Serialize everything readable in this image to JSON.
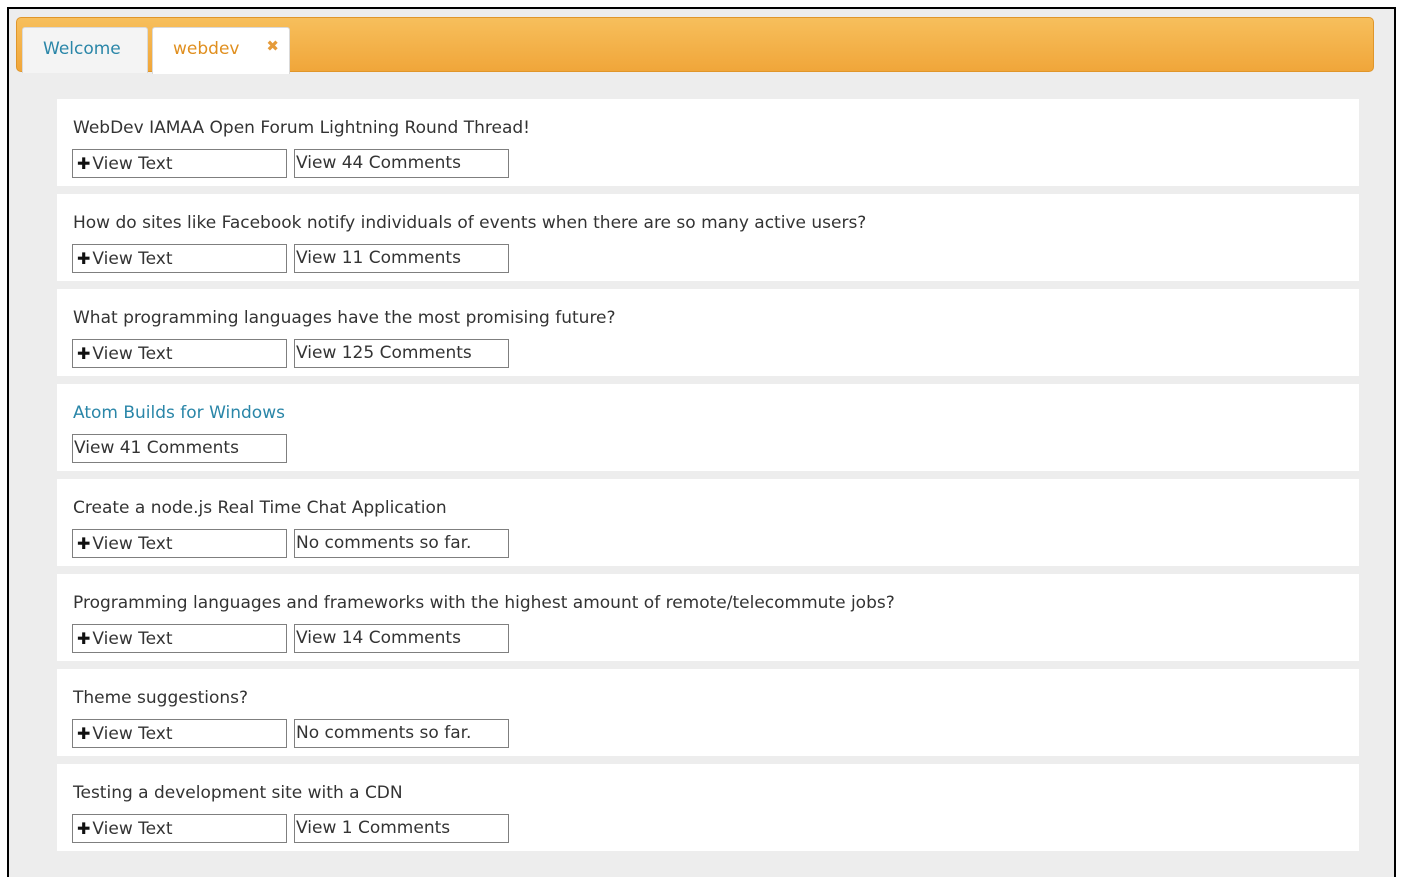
{
  "tabs": [
    {
      "label": "Welcome"
    },
    {
      "label": "webdev",
      "close": "✖"
    }
  ],
  "posts": [
    {
      "title": "WebDev IAMAA Open Forum Lightning Round Thread!",
      "view_text": "View Text",
      "comments": "View 44 Comments",
      "is_link": false,
      "has_text": true
    },
    {
      "title": "How do sites like Facebook notify individuals of events when there are so many active users?",
      "view_text": "View Text",
      "comments": "View 11 Comments",
      "is_link": false,
      "has_text": true
    },
    {
      "title": "What programming languages have the most promising future?",
      "view_text": "View Text",
      "comments": "View 125 Comments",
      "is_link": false,
      "has_text": true
    },
    {
      "title": "Atom Builds for Windows",
      "view_text": "",
      "comments": "View 41 Comments",
      "is_link": true,
      "has_text": false
    },
    {
      "title": "Create a node.js Real Time Chat Application",
      "view_text": "View Text",
      "comments": "No comments so far.",
      "is_link": false,
      "has_text": true
    },
    {
      "title": "Programming languages and frameworks with the highest amount of remote/telecommute jobs?",
      "view_text": "View Text",
      "comments": "View 14 Comments",
      "is_link": false,
      "has_text": true
    },
    {
      "title": "Theme suggestions?",
      "view_text": "View Text",
      "comments": "No comments so far.",
      "is_link": false,
      "has_text": true
    },
    {
      "title": "Testing a development site with a CDN",
      "view_text": "View Text",
      "comments": "View 1 Comments",
      "is_link": false,
      "has_text": true
    }
  ],
  "colors": {
    "tab_bar": "#f0a63a",
    "link": "#2a86a8",
    "background": "#ededed"
  }
}
